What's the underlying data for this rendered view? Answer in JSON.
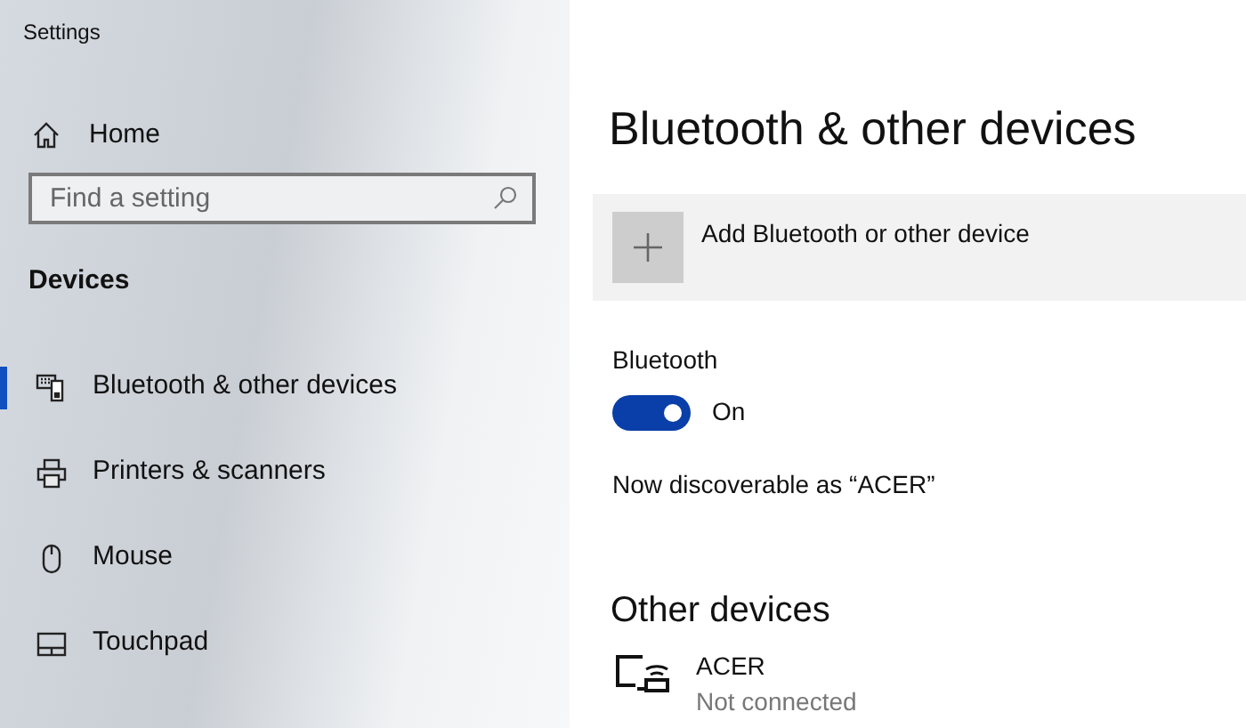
{
  "window": {
    "title": "Settings"
  },
  "home": {
    "label": "Home"
  },
  "search": {
    "placeholder": "Find a setting"
  },
  "section": "Devices",
  "nav": [
    {
      "label": "Bluetooth & other devices",
      "kind": "bluetooth",
      "selected": true
    },
    {
      "label": "Printers & scanners",
      "kind": "printer",
      "selected": false
    },
    {
      "label": "Mouse",
      "kind": "mouse",
      "selected": false
    },
    {
      "label": "Touchpad",
      "kind": "touchpad",
      "selected": false
    }
  ],
  "page": {
    "title": "Bluetooth & other devices",
    "add_button": "Add Bluetooth or other device",
    "bluetooth": {
      "label": "Bluetooth",
      "on": true,
      "state_text": "On"
    },
    "discoverable": "Now discoverable as “ACER”"
  },
  "other_devices": {
    "title": "Other devices",
    "devices": [
      {
        "name": "ACER",
        "status": "Not connected"
      }
    ]
  }
}
